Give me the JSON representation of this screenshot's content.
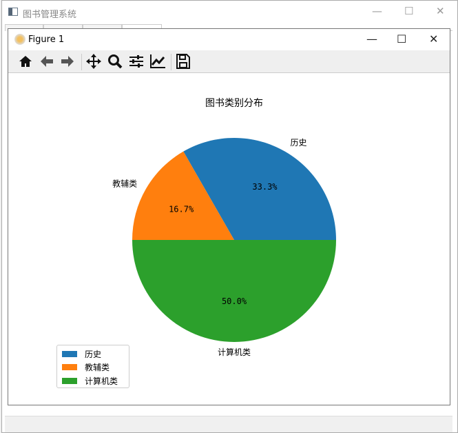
{
  "main_window": {
    "title": "图书管理系统",
    "controls": [
      "—",
      "☐",
      "✕"
    ]
  },
  "figure_window": {
    "title": "Figure 1",
    "controls": [
      "—",
      "☐",
      "✕"
    ]
  },
  "toolbar": [
    "home-icon",
    "back-icon",
    "forward-icon",
    "pan-icon",
    "zoom-icon",
    "configure-subplots-icon",
    "edit-axes-icon",
    "save-icon"
  ],
  "chart_data": {
    "type": "pie",
    "title": "图书类别分布",
    "categories": [
      "历史",
      "教辅类",
      "计算机类"
    ],
    "values": [
      33.3,
      16.7,
      50.0
    ],
    "pct_labels": [
      "33.3%",
      "16.7%",
      "50.0%"
    ],
    "colors": [
      "#1f77b4",
      "#ff7f0e",
      "#2ca02c"
    ],
    "startangle": 0,
    "legend": {
      "placement": "lower-left",
      "entries": [
        "历史",
        "教辅类",
        "计算机类"
      ]
    }
  }
}
